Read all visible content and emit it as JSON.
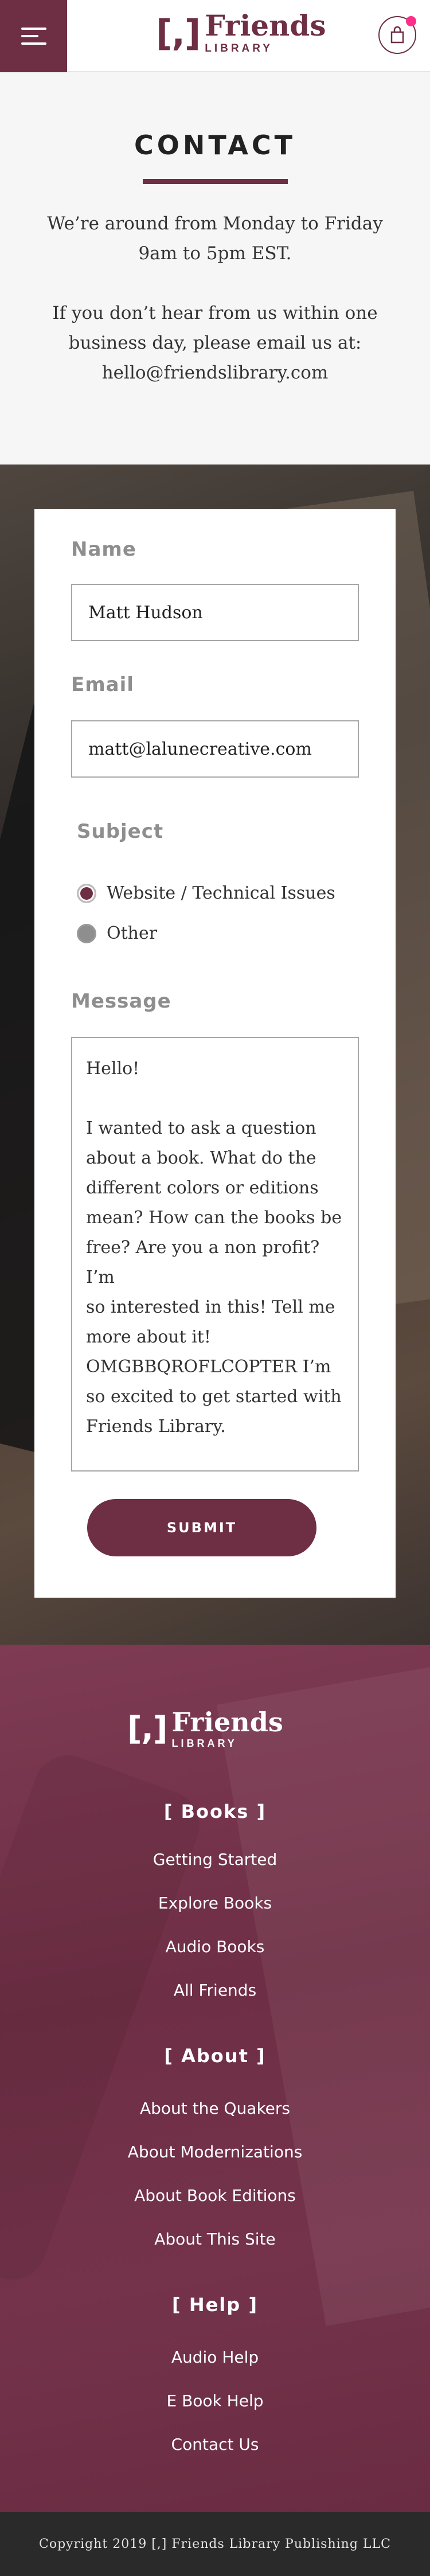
{
  "header": {
    "logo_mark": "[,]",
    "logo_name": "Friends",
    "logo_sub": "LIBRARY",
    "brand_color": "#6e2e43",
    "cart_badge_color": "#ff2e88",
    "menu_icon": "hamburger-icon",
    "cart_icon": "shopping-bag-icon"
  },
  "intro": {
    "title": "CONTACT",
    "paragraph1": "We’re around from Monday to Friday 9am to 5pm EST.",
    "paragraph2": "If you don’t hear from us within one business day, please email us at: hello@friendslibrary.com"
  },
  "form": {
    "name_label": "Name",
    "name_value": "Matt Hudson",
    "email_label": "Email",
    "email_value": "matt@lalunecreative.com",
    "subject_label": "Subject",
    "subject_options": [
      {
        "label": "Website / Technical Issues",
        "checked": true
      },
      {
        "label": "Other",
        "checked": false
      }
    ],
    "message_label": "Message",
    "message_lines": [
      "Hello!",
      "",
      "I wanted to ask a question",
      "about a book. What do the",
      "different colors or editions",
      "mean? How can the books be",
      "free? Are you a non profit? I’m",
      "so interested in this! Tell me",
      "more about it!",
      "OMGBBQROFLCOPTER I’m",
      "so excited to get started with",
      "Friends Library."
    ],
    "submit_label": "SUBMIT"
  },
  "footer": {
    "logo_mark": "[,]",
    "logo_name": "Friends",
    "logo_sub": "LIBRARY",
    "sections": [
      {
        "heading": "[ Books ]",
        "links": [
          "Getting Started",
          "Explore Books",
          "Audio Books",
          "All Friends"
        ]
      },
      {
        "heading": "[ About ]",
        "links": [
          "About the Quakers",
          "About Modernizations",
          "About Book Editions",
          "About This Site"
        ]
      },
      {
        "heading": "[ Help ]",
        "links": [
          "Audio Help",
          "E Book Help",
          "Contact Us"
        ]
      }
    ],
    "copyright": "Copyright 2019 [,] Friends Library Publishing LLC"
  }
}
